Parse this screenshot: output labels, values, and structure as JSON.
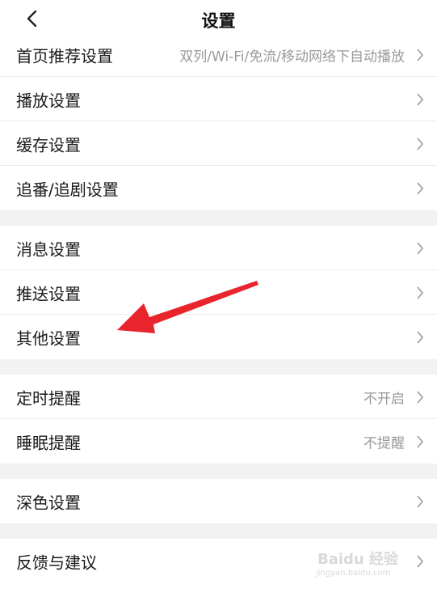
{
  "header": {
    "title": "设置"
  },
  "groups": [
    {
      "items": [
        {
          "label": "首页推荐设置",
          "value": "双列/Wi-Fi/免流/移动网络下自动播放"
        },
        {
          "label": "播放设置",
          "value": ""
        },
        {
          "label": "缓存设置",
          "value": ""
        },
        {
          "label": "追番/追剧设置",
          "value": ""
        }
      ]
    },
    {
      "items": [
        {
          "label": "消息设置",
          "value": ""
        },
        {
          "label": "推送设置",
          "value": ""
        },
        {
          "label": "其他设置",
          "value": ""
        }
      ]
    },
    {
      "items": [
        {
          "label": "定时提醒",
          "value": "不开启"
        },
        {
          "label": "睡眠提醒",
          "value": "不提醒"
        }
      ]
    },
    {
      "items": [
        {
          "label": "深色设置",
          "value": ""
        }
      ]
    },
    {
      "items": [
        {
          "label": "反馈与建议",
          "value": ""
        }
      ]
    }
  ],
  "annotation": {
    "arrow_color": "#e8242c"
  },
  "watermark": {
    "brand": "Baidu 经验",
    "url": "jingyan.baidu.com"
  },
  "colors": {
    "background": "#f2f2f2",
    "row": "#ffffff",
    "secondary_text": "#9a9a9a"
  }
}
